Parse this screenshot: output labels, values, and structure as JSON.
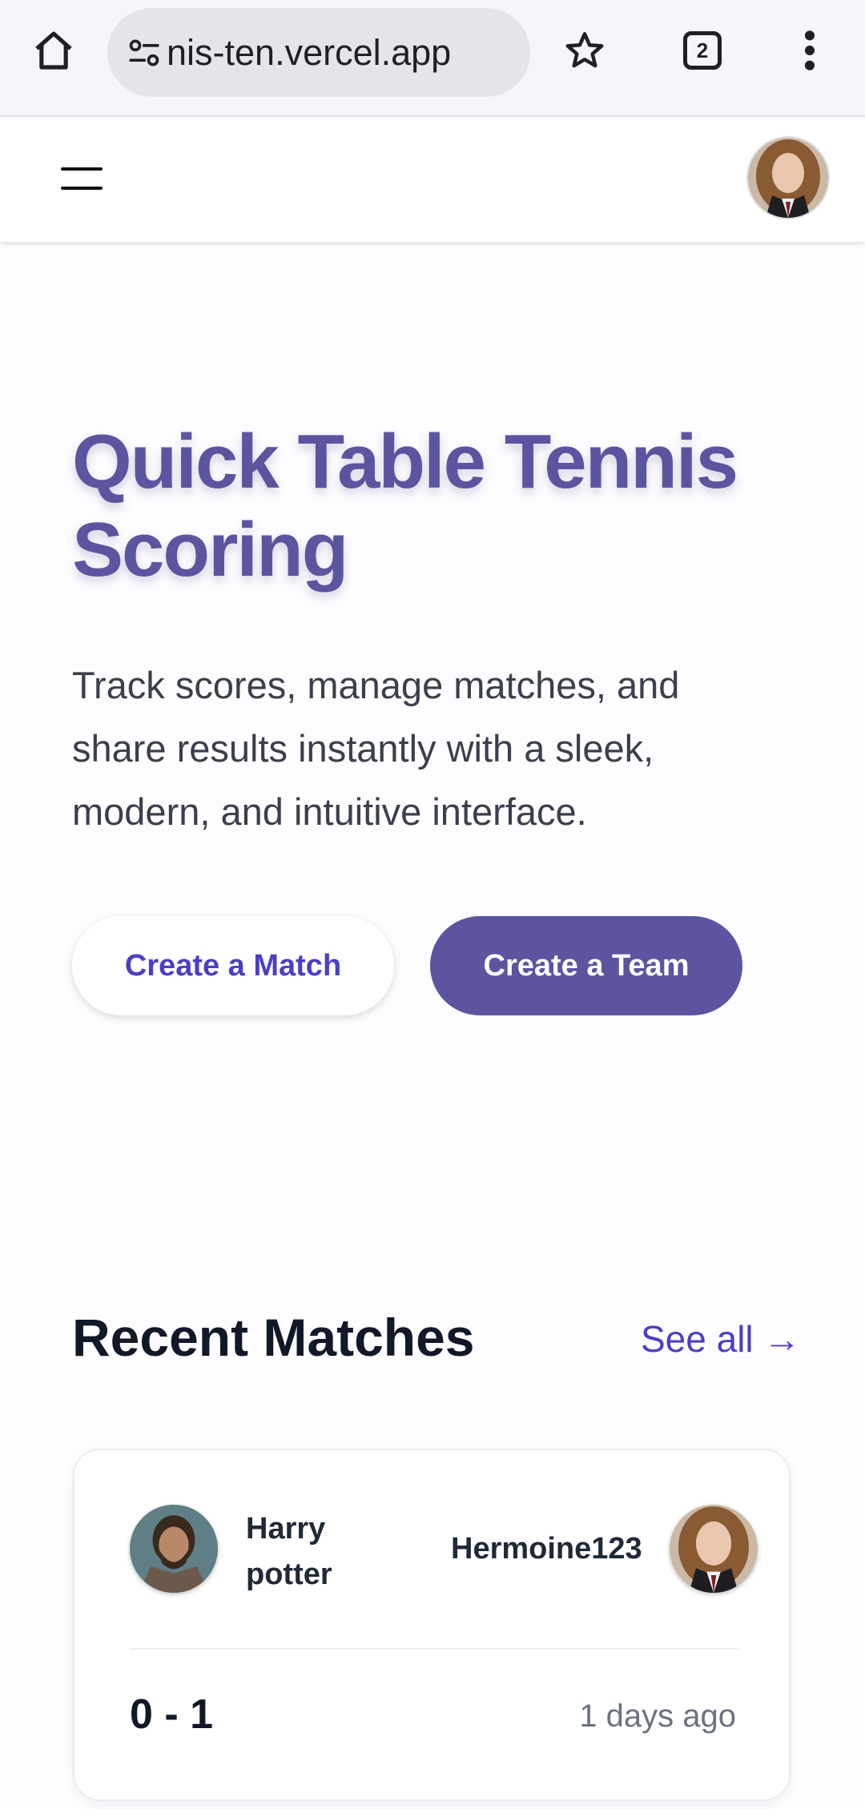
{
  "browser": {
    "url": "nis-ten.vercel.app",
    "tab_count": "2"
  },
  "hero": {
    "title": "Quick Table Tennis Scoring",
    "description": "Track scores, manage matches, and share results instantly with a sleek, modern, and intuitive interface.",
    "create_match_label": "Create a Match",
    "create_team_label": "Create a Team"
  },
  "recent_matches": {
    "title": "Recent Matches",
    "see_all_label": "See all →",
    "matches": [
      {
        "player1": "Harry potter",
        "player2": "Hermoine123",
        "score": "0 - 1",
        "time": "1 days ago"
      }
    ]
  },
  "colors": {
    "primary": "#5b55a0",
    "link": "#4a3fc4",
    "text_dark": "#111827",
    "text_muted": "#6b7280"
  }
}
